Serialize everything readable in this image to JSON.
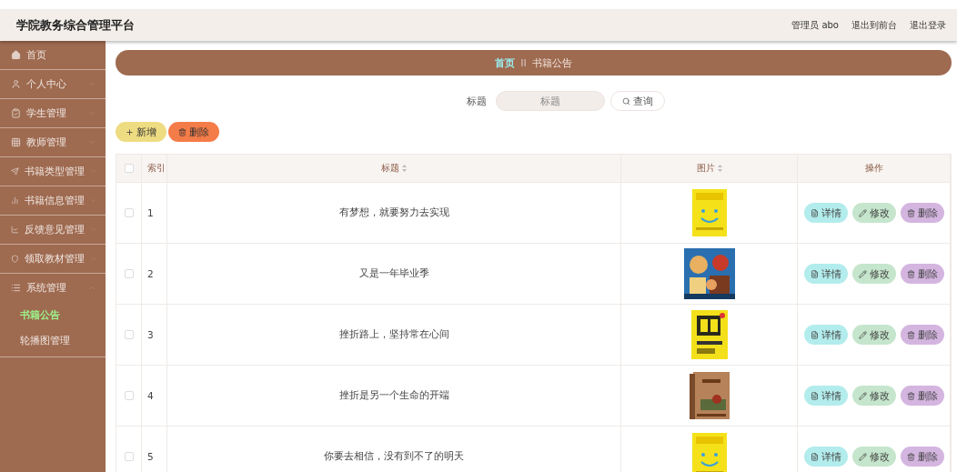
{
  "header": {
    "title": "学院教务综合管理平台",
    "links": [
      "管理员 abo",
      "退出到前台",
      "退出登录"
    ]
  },
  "sidebar": {
    "items": [
      {
        "label": "首页"
      },
      {
        "label": "个人中心",
        "expanded": false
      },
      {
        "label": "学生管理",
        "expanded": false
      },
      {
        "label": "教师管理",
        "expanded": false
      },
      {
        "label": "书籍类型管理",
        "expanded": false
      },
      {
        "label": "书籍信息管理",
        "expanded": false
      },
      {
        "label": "反馈意见管理",
        "expanded": false
      },
      {
        "label": "领取教材管理",
        "expanded": false
      },
      {
        "label": "系统管理",
        "expanded": true,
        "children": [
          {
            "label": "书籍公告",
            "selected": true
          },
          {
            "label": "轮播图管理",
            "selected": false
          }
        ]
      }
    ]
  },
  "breadcrumb": [
    {
      "label": "首页",
      "current": false
    },
    {
      "label": "书籍公告",
      "current": true
    }
  ],
  "breadcrumb_separator": "II",
  "search": {
    "label": "标题",
    "placeholder": "标题",
    "button": "查询"
  },
  "actions": [
    {
      "label": "新增",
      "kind": "add"
    },
    {
      "label": "删除",
      "kind": "delete"
    }
  ],
  "table": {
    "columns": [
      {
        "label": "索引",
        "sortable": false
      },
      {
        "label": "标题",
        "sortable": true
      },
      {
        "label": "图片",
        "sortable": true
      },
      {
        "label": "操作",
        "sortable": false
      }
    ],
    "header_checked": false,
    "rows": [
      {
        "index": "1",
        "title": "有梦想，就要努力去实现",
        "checked": false,
        "actions": [
          {
            "label": "详情",
            "kind": "detail"
          },
          {
            "label": "修改",
            "kind": "edit"
          },
          {
            "label": "删除",
            "kind": "delete"
          }
        ]
      },
      {
        "index": "2",
        "title": "又是一年毕业季",
        "checked": false,
        "actions": [
          {
            "label": "详情",
            "kind": "detail"
          },
          {
            "label": "修改",
            "kind": "edit"
          },
          {
            "label": "删除",
            "kind": "delete"
          }
        ]
      },
      {
        "index": "3",
        "title": "挫折路上，坚持常在心间",
        "checked": false,
        "actions": [
          {
            "label": "详情",
            "kind": "detail"
          },
          {
            "label": "修改",
            "kind": "edit"
          },
          {
            "label": "删除",
            "kind": "delete"
          }
        ]
      },
      {
        "index": "4",
        "title": "挫折是另一个生命的开端",
        "checked": false,
        "actions": [
          {
            "label": "详情",
            "kind": "detail"
          },
          {
            "label": "修改",
            "kind": "edit"
          },
          {
            "label": "删除",
            "kind": "delete"
          }
        ]
      },
      {
        "index": "5",
        "title": "你要去相信，没有到不了的明天",
        "checked": false,
        "actions": [
          {
            "label": "详情",
            "kind": "detail"
          },
          {
            "label": "修改",
            "kind": "edit"
          },
          {
            "label": "删除",
            "kind": "delete"
          }
        ]
      }
    ]
  }
}
